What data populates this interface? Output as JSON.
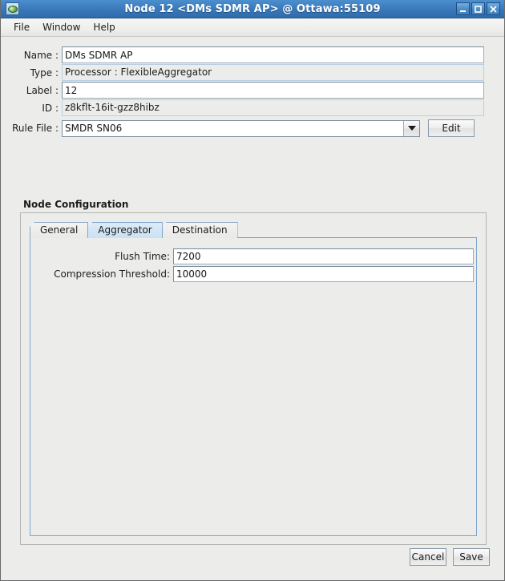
{
  "window": {
    "title": "Node 12 <DMs SDMR AP> @ Ottawa:55109",
    "app_icon": "node-app-icon",
    "controls": {
      "minimize": "minimize-icon",
      "maximize": "maximize-icon",
      "close": "close-icon"
    }
  },
  "menubar": {
    "items": [
      {
        "label": "File"
      },
      {
        "label": "Window"
      },
      {
        "label": "Help"
      }
    ]
  },
  "form": {
    "fields": [
      {
        "label": "Name :",
        "value": "DMs SDMR AP",
        "readonly": false
      },
      {
        "label": "Type :",
        "value": "Processor : FlexibleAggregator",
        "readonly": true
      },
      {
        "label": "Label :",
        "value": "12",
        "readonly": false
      },
      {
        "label": "ID :",
        "value": "z8kflt-16it-gzz8hibz",
        "readonly": true
      }
    ],
    "rule_file": {
      "label": "Rule File :",
      "value": "SMDR SN06",
      "dropdown_icon": "chevron-down-icon",
      "edit_label": "Edit"
    }
  },
  "node_configuration": {
    "title": "Node  Configuration",
    "tabs": [
      {
        "label": "General",
        "selected": false
      },
      {
        "label": "Aggregator",
        "selected": true
      },
      {
        "label": "Destination",
        "selected": false
      }
    ],
    "aggregator": {
      "fields": [
        {
          "label": "Flush Time:",
          "value": "7200"
        },
        {
          "label": "Compression Threshold:",
          "value": "10000"
        }
      ]
    }
  },
  "footer": {
    "cancel_label": "Cancel",
    "save_label": "Save"
  },
  "colors": {
    "titlebar": "#3d7cbd",
    "tab_selected": "#cbe1f4",
    "panel_border": "#7ba3cc",
    "background": "#ececeb"
  }
}
